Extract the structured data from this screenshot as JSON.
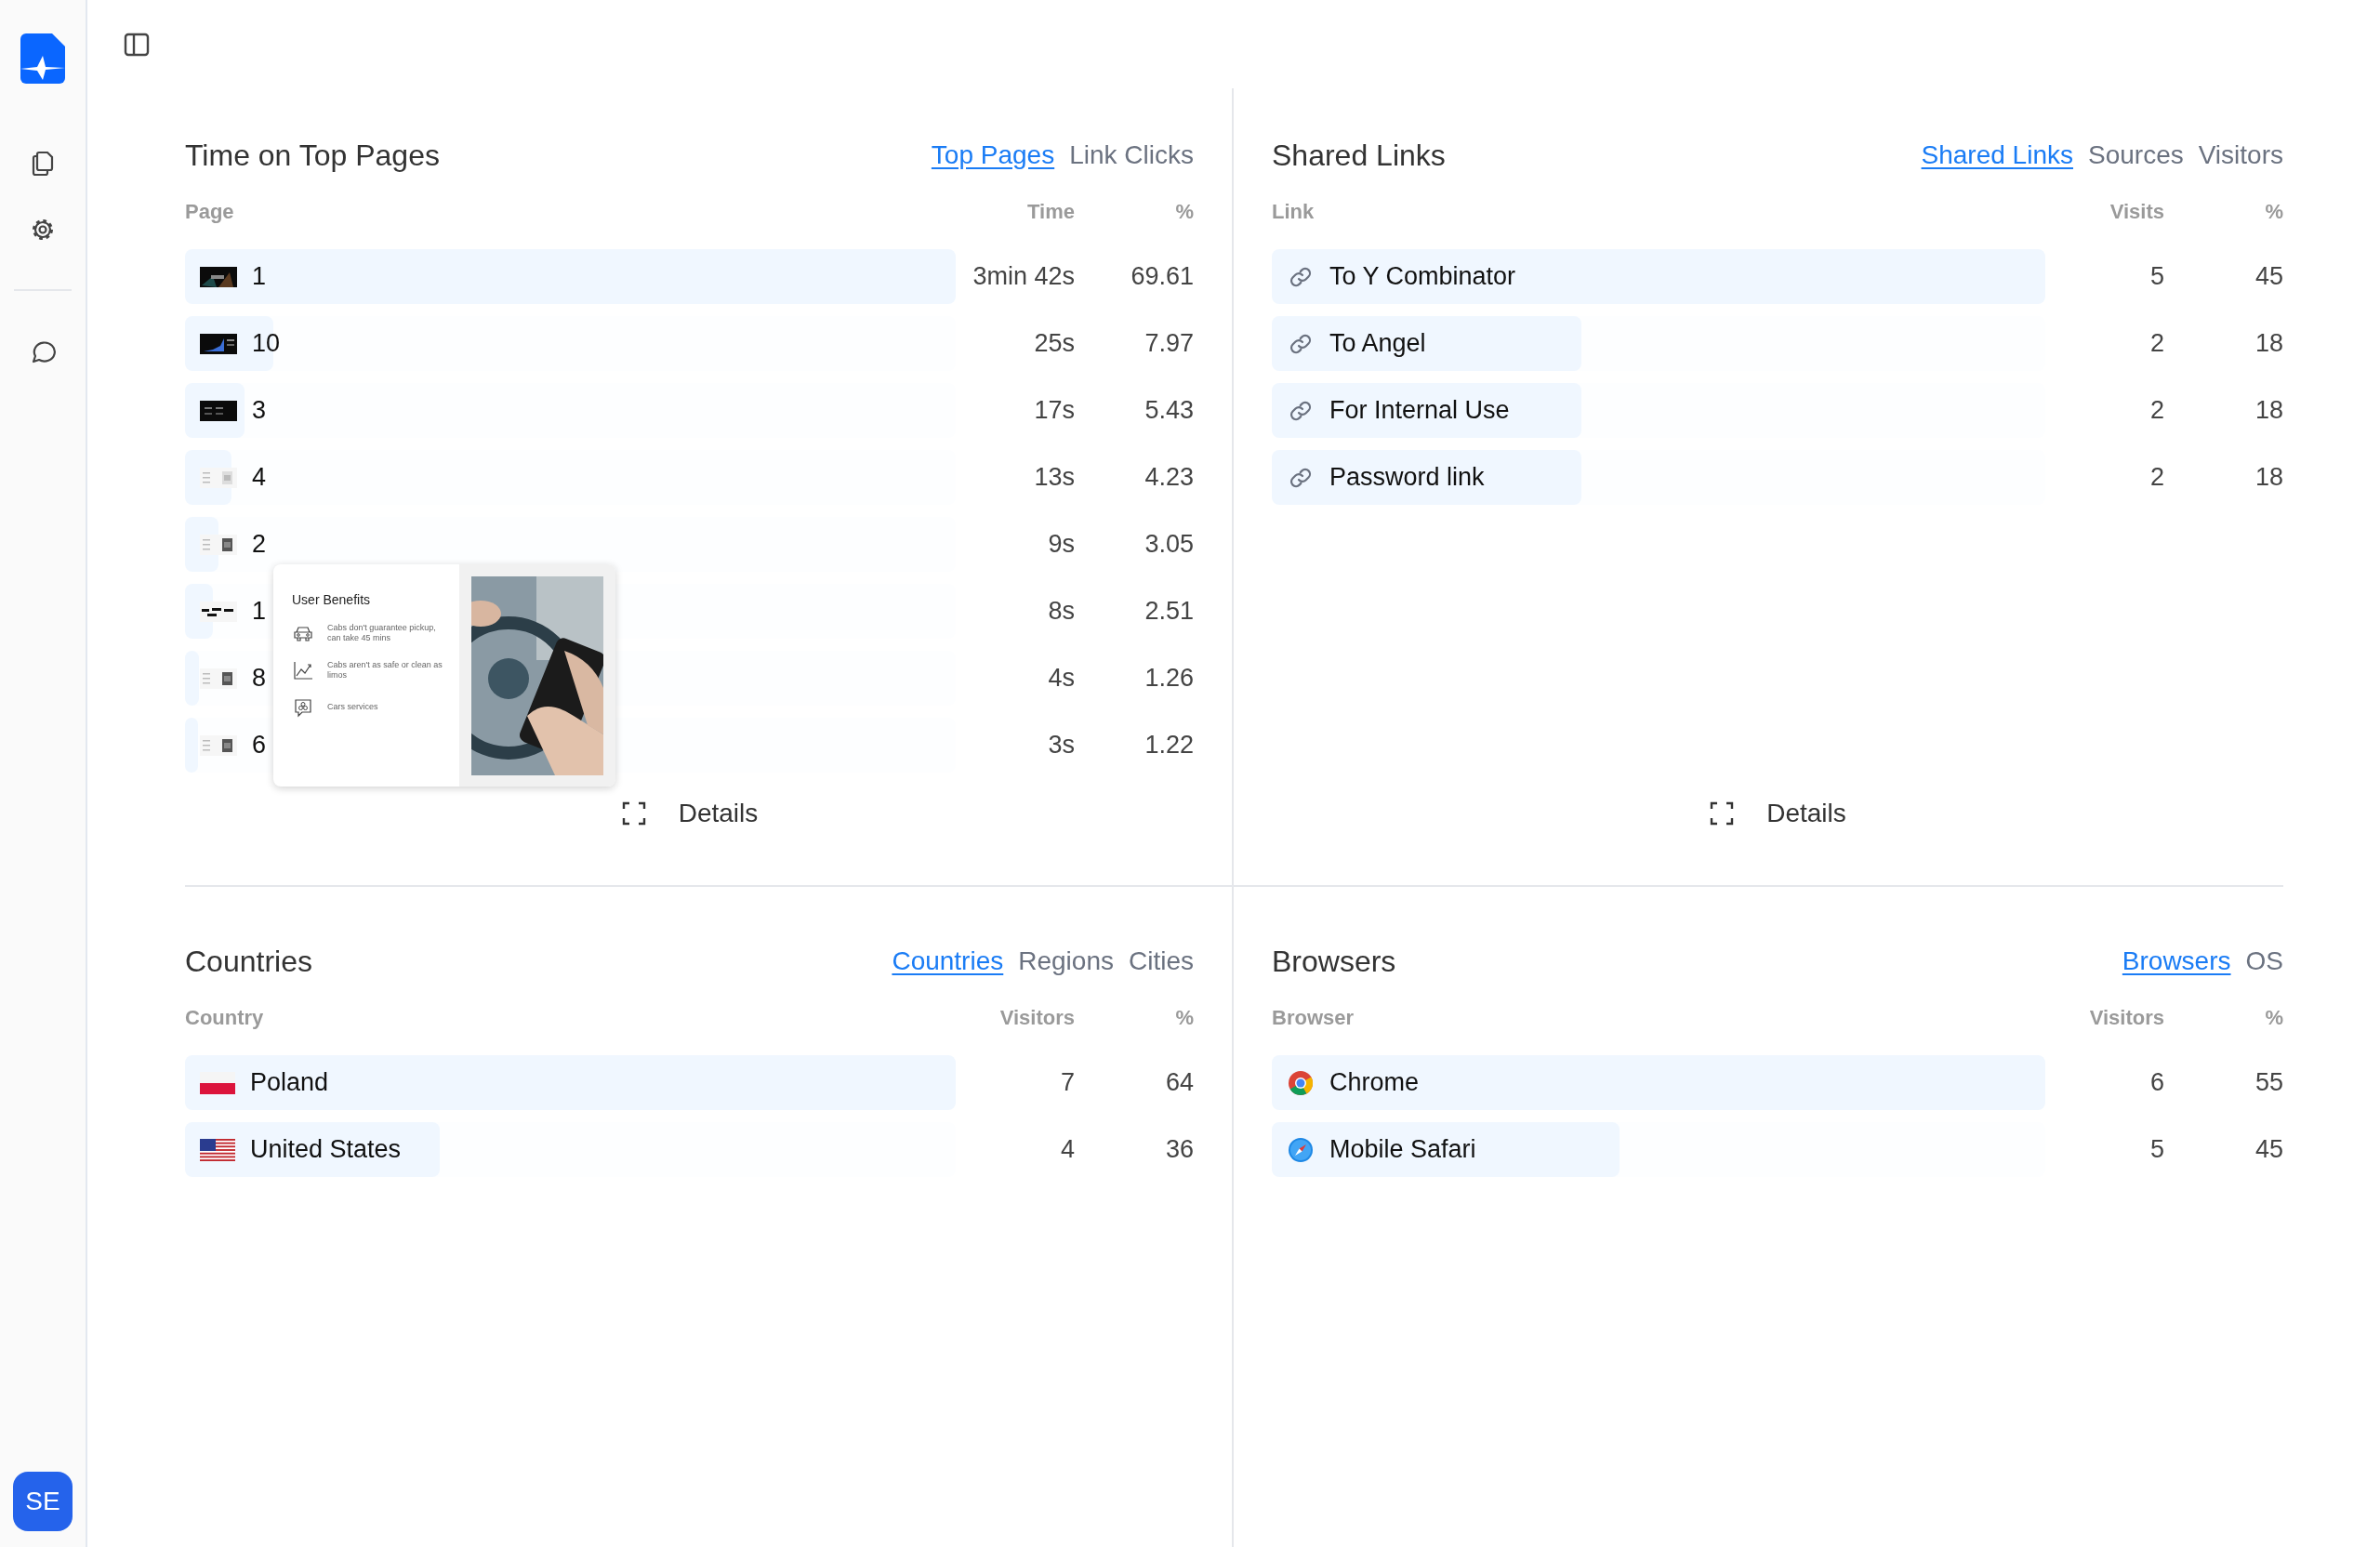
{
  "sidebar": {
    "avatar": {
      "initials": "SE"
    }
  },
  "panels": [
    {
      "kind": "pages",
      "title": "Time on Top Pages",
      "tabs": [
        {
          "label": "Top Pages",
          "selected": true
        },
        {
          "label": "Link Clicks",
          "selected": false
        }
      ],
      "columns": [
        "Page",
        "Time",
        "%"
      ],
      "rows": [
        {
          "label": "1",
          "value": "3min 42s",
          "percent": "69.61",
          "level": 1
        },
        {
          "label": "10",
          "value": "25s",
          "percent": "7.97",
          "level": 0.115
        },
        {
          "label": "3",
          "value": "17s",
          "percent": "5.43",
          "level": 0.077
        },
        {
          "label": "4",
          "value": "13s",
          "percent": "4.23",
          "level": 0.06
        },
        {
          "label": "2",
          "value": "9s",
          "percent": "3.05",
          "level": 0.043
        },
        {
          "label": "1",
          "value": "8s",
          "percent": "2.51",
          "level": 0.036
        },
        {
          "label": "8",
          "value": "4s",
          "percent": "1.26",
          "level": 0.018
        },
        {
          "label": "6",
          "value": "3s",
          "percent": "1.22",
          "level": 0.017
        }
      ],
      "preview": {
        "title": "User Benefits",
        "items": [
          "Cabs don't guarantee pickup, can take 45 mins",
          "Cabs aren't as safe or clean as limos",
          "Cars services"
        ]
      },
      "details": "Details"
    },
    {
      "kind": "links",
      "title": "Shared Links",
      "tabs": [
        {
          "label": "Shared Links",
          "selected": true
        },
        {
          "label": "Sources",
          "selected": false
        },
        {
          "label": "Visitors",
          "selected": false
        }
      ],
      "columns": [
        "Link",
        "Visits",
        "%"
      ],
      "rows": [
        {
          "label": "To Y Combinator",
          "value": "5",
          "percent": "45",
          "level": 1
        },
        {
          "label": "To Angel",
          "value": "2",
          "percent": "18",
          "level": 0.4
        },
        {
          "label": "For Internal Use",
          "value": "2",
          "percent": "18",
          "level": 0.4
        },
        {
          "label": "Password link",
          "value": "2",
          "percent": "18",
          "level": 0.4
        }
      ],
      "details": "Details"
    },
    {
      "kind": "countries",
      "title": "Countries",
      "tabs": [
        {
          "label": "Countries",
          "selected": true
        },
        {
          "label": "Regions",
          "selected": false
        },
        {
          "label": "Cities",
          "selected": false
        }
      ],
      "columns": [
        "Country",
        "Visitors",
        "%"
      ],
      "rows": [
        {
          "label": "Poland",
          "value": "7",
          "percent": "64",
          "level": 1
        },
        {
          "label": "United States",
          "value": "4",
          "percent": "36",
          "level": 0.33
        }
      ]
    },
    {
      "kind": "browsers",
      "title": "Browsers",
      "tabs": [
        {
          "label": "Browsers",
          "selected": true
        },
        {
          "label": "OS",
          "selected": false
        }
      ],
      "columns": [
        "Browser",
        "Visitors",
        "%"
      ],
      "rows": [
        {
          "label": "Chrome",
          "value": "6",
          "percent": "55",
          "level": 1
        },
        {
          "label": "Mobile Safari",
          "value": "5",
          "percent": "45",
          "level": 0.45
        }
      ]
    }
  ]
}
